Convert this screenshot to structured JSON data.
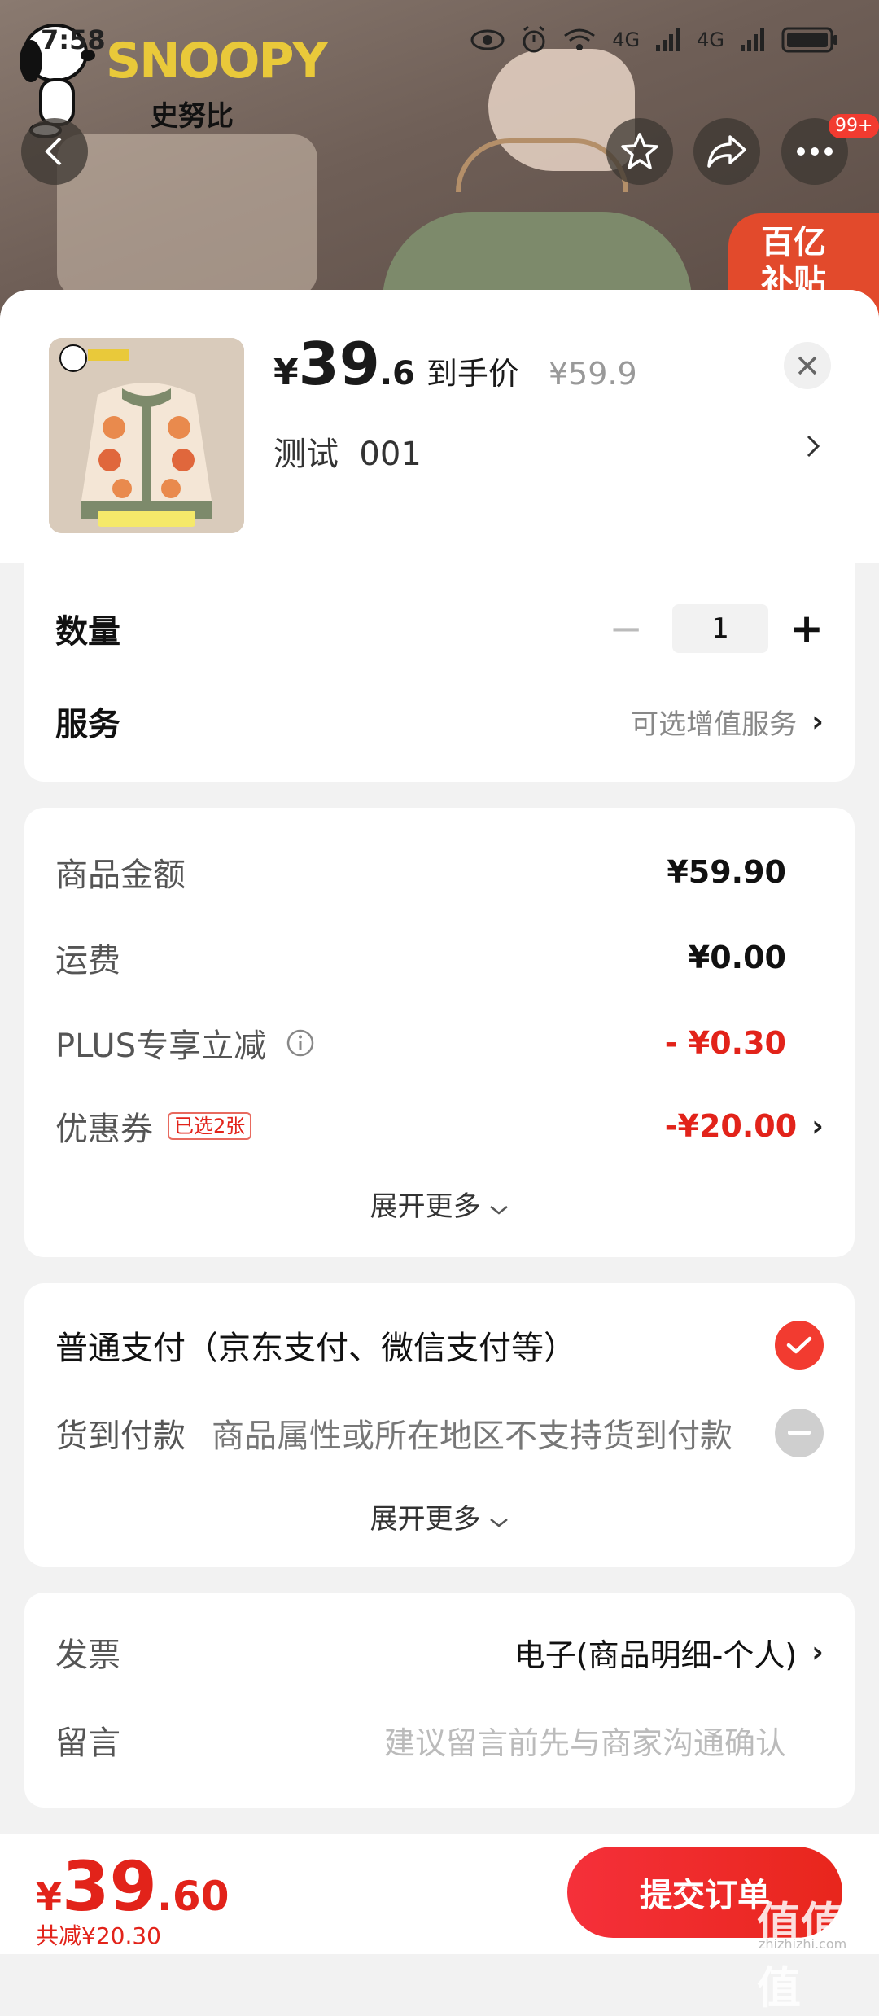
{
  "status_bar": {
    "time": "7:58",
    "network_1": "4G",
    "network_2": "4G"
  },
  "banner": {
    "brand": "SNOOPY",
    "brand_cn": "史努比",
    "subsidy": "百亿\n补贴",
    "more_badge": "99+"
  },
  "product": {
    "price_currency": "¥",
    "price_int": "39",
    "price_dec": ".6",
    "price_label": "到手价",
    "original_price": "¥59.9",
    "spec": "测试  001"
  },
  "options": {
    "quantity_label": "数量",
    "quantity_value": "1",
    "service_label": "服务",
    "service_value": "可选增值服务"
  },
  "amounts": {
    "goods_label": "商品金额",
    "goods_value": "¥59.90",
    "shipping_label": "运费",
    "shipping_value": "¥0.00",
    "plus_label": "PLUS专享立减",
    "plus_value": "- ¥0.30",
    "coupon_label": "优惠券",
    "coupon_tag": "已选2张",
    "coupon_value": "-¥20.00",
    "expand": "展开更多"
  },
  "payment": {
    "normal_label": "普通支付（京东支付、微信支付等）",
    "cod_label": "货到付款",
    "cod_note": "商品属性或所在地区不支持货到付款",
    "expand": "展开更多"
  },
  "extra": {
    "invoice_label": "发票",
    "invoice_value": "电子(商品明细-个人)",
    "message_label": "留言",
    "message_placeholder": "建议留言前先与商家沟通确认"
  },
  "footer": {
    "total_currency": "¥",
    "total_int": "39",
    "total_dec": ".60",
    "saved": "共减¥20.30",
    "submit": "提交订单"
  },
  "watermark": {
    "mark": "值值值",
    "site": "zhizhizhi.com"
  },
  "colors": {
    "accent_red": "#e2231a",
    "brand_yellow": "#e9c93a"
  }
}
